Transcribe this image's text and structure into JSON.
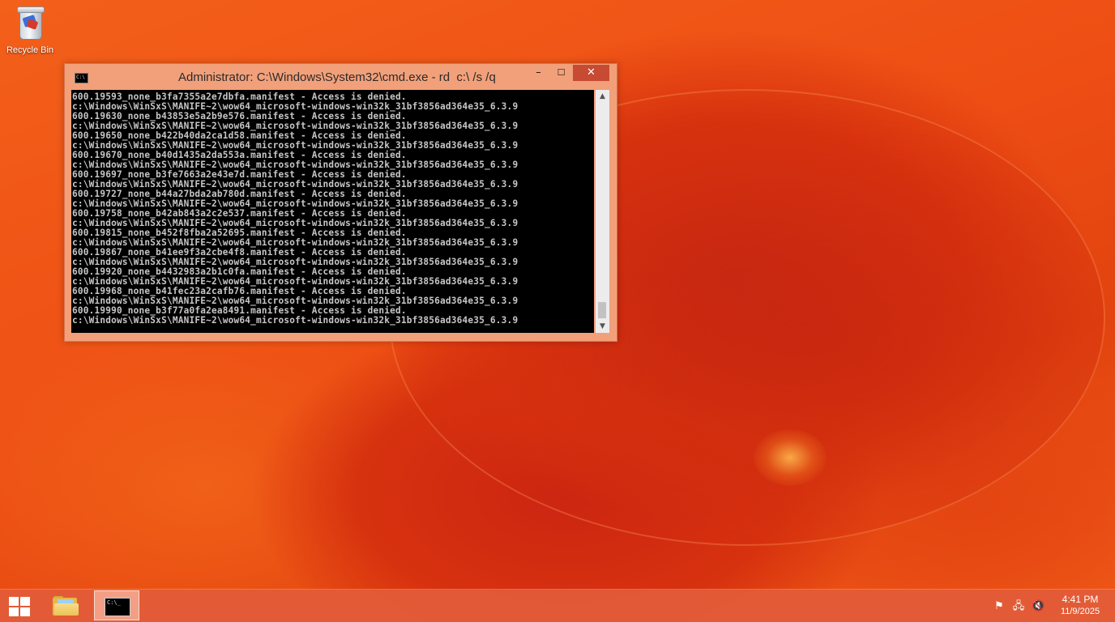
{
  "desktop": {
    "icons": [
      {
        "label": "Recycle Bin",
        "icon": "recycle-bin-icon"
      }
    ]
  },
  "cmd_window": {
    "title": "Administrator: C:\\Windows\\System32\\cmd.exe - rd  c:\\ /s /q",
    "icon": "cmd-icon",
    "buttons": {
      "minimize": "–",
      "maximize": "☐",
      "close": "✕"
    },
    "console_lines": [
      "600.19593_none_b3fa7355a2e7dbfa.manifest - Access is denied.",
      "c:\\Windows\\WinSxS\\MANIFE~2\\wow64_microsoft-windows-win32k_31bf3856ad364e35_6.3.9",
      "600.19630_none_b43853e5a2b9e576.manifest - Access is denied.",
      "c:\\Windows\\WinSxS\\MANIFE~2\\wow64_microsoft-windows-win32k_31bf3856ad364e35_6.3.9",
      "600.19650_none_b422b40da2ca1d58.manifest - Access is denied.",
      "c:\\Windows\\WinSxS\\MANIFE~2\\wow64_microsoft-windows-win32k_31bf3856ad364e35_6.3.9",
      "600.19670_none_b40d1435a2da553a.manifest - Access is denied.",
      "c:\\Windows\\WinSxS\\MANIFE~2\\wow64_microsoft-windows-win32k_31bf3856ad364e35_6.3.9",
      "600.19697_none_b3fe7663a2e43e7d.manifest - Access is denied.",
      "c:\\Windows\\WinSxS\\MANIFE~2\\wow64_microsoft-windows-win32k_31bf3856ad364e35_6.3.9",
      "600.19727_none_b44a27bda2ab780d.manifest - Access is denied.",
      "c:\\Windows\\WinSxS\\MANIFE~2\\wow64_microsoft-windows-win32k_31bf3856ad364e35_6.3.9",
      "600.19758_none_b42ab843a2c2e537.manifest - Access is denied.",
      "c:\\Windows\\WinSxS\\MANIFE~2\\wow64_microsoft-windows-win32k_31bf3856ad364e35_6.3.9",
      "600.19815_none_b452f8fba2a52695.manifest - Access is denied.",
      "c:\\Windows\\WinSxS\\MANIFE~2\\wow64_microsoft-windows-win32k_31bf3856ad364e35_6.3.9",
      "600.19867_none_b41ee9f3a2cbe4f8.manifest - Access is denied.",
      "c:\\Windows\\WinSxS\\MANIFE~2\\wow64_microsoft-windows-win32k_31bf3856ad364e35_6.3.9",
      "600.19920_none_b4432983a2b1c0fa.manifest - Access is denied.",
      "c:\\Windows\\WinSxS\\MANIFE~2\\wow64_microsoft-windows-win32k_31bf3856ad364e35_6.3.9",
      "600.19968_none_b41fec23a2cafb76.manifest - Access is denied.",
      "c:\\Windows\\WinSxS\\MANIFE~2\\wow64_microsoft-windows-win32k_31bf3856ad364e35_6.3.9",
      "600.19990_none_b3f77a0fa2ea8491.manifest - Access is denied.",
      "c:\\Windows\\WinSxS\\MANIFE~2\\wow64_microsoft-windows-win32k_31bf3856ad364e35_6.3.9"
    ],
    "scrollbar": {
      "up_arrow": "▲",
      "down_arrow": "▼"
    }
  },
  "taskbar": {
    "start_icon": "windows-logo-icon",
    "pinned": [
      {
        "name": "file-explorer",
        "icon": "folder-icon"
      },
      {
        "name": "command-prompt",
        "icon": "cmd-icon",
        "active": true
      }
    ],
    "tray": {
      "flag_icon": "⚑",
      "network_icon": "🖧",
      "volume_icon": "🔇",
      "time": "4:41 PM",
      "date": "11/9/2025"
    }
  },
  "colors": {
    "wallpaper": "#ee5215",
    "taskbar": "#e25c3a",
    "window_frame": "#f2a07a",
    "close_button": "#c74a33",
    "console_bg": "#000000",
    "console_text": "#c6c6c6"
  }
}
